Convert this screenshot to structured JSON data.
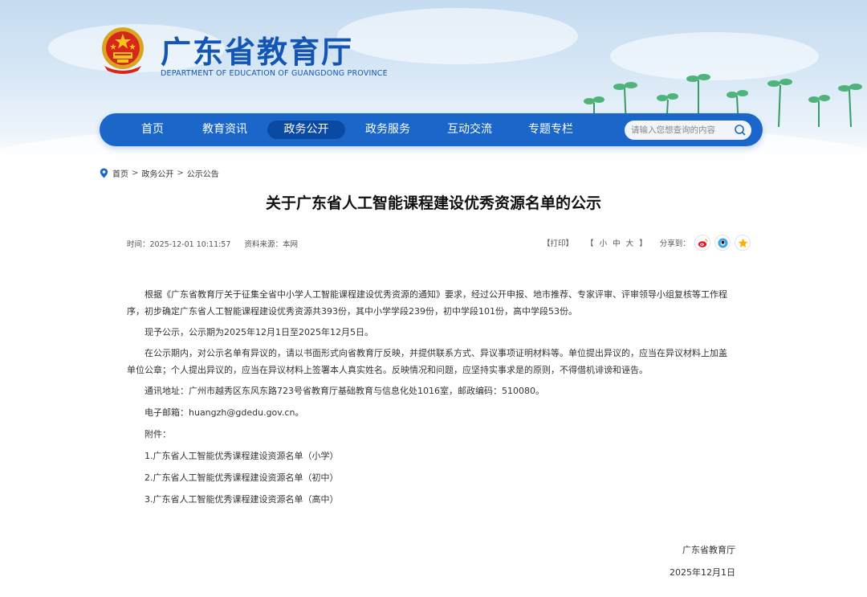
{
  "header": {
    "site_title": "广东省教育厅",
    "site_subtitle": "DEPARTMENT OF EDUCATION OF GUANGDONG PROVINCE"
  },
  "nav": {
    "items": [
      {
        "label": "首页",
        "active": false
      },
      {
        "label": "教育资讯",
        "active": false
      },
      {
        "label": "政务公开",
        "active": true
      },
      {
        "label": "政务服务",
        "active": false
      },
      {
        "label": "互动交流",
        "active": false
      },
      {
        "label": "专题专栏",
        "active": false
      }
    ],
    "search_placeholder": "请输入您想查询的内容"
  },
  "breadcrumb": [
    "首页",
    "政务公开",
    "公示公告"
  ],
  "article": {
    "title": "关于广东省人工智能课程建设优秀资源名单的公示",
    "time_label": "时间：2025-12-01 10:11:57",
    "source_label": "资料来源：本网",
    "print_label": "【打印】",
    "size_open": "【",
    "size_small": "小",
    "size_medium": "中",
    "size_large": "大",
    "size_close": "】",
    "share_label": "分享到：",
    "paragraphs": [
      "根据《广东省教育厅关于征集全省中小学人工智能课程建设优秀资源的通知》要求，经过公开申报、地市推荐、专家评审、评审领导小组复核等工作程序，初步确定广东省人工智能课程建设优秀资源共393份，其中小学学段239份，初中学段101份，高中学段53份。",
      "现予公示，公示期为2025年12月1日至2025年12月5日。",
      "在公示期内，对公示名单有异议的，请以书面形式向省教育厅反映，并提供联系方式、异议事项证明材料等。单位提出异议的，应当在异议材料上加盖单位公章；个人提出异议的，应当在异议材料上签署本人真实姓名。反映情况和问题，应坚持实事求是的原则，不得借机诽谤和诬告。",
      "通讯地址：广州市越秀区东风东路723号省教育厅基础教育与信息化处1016室，邮政编码：510080。",
      "电子邮箱：huangzh@gdedu.gov.cn。",
      "附件：",
      "1.广东省人工智能优秀课程建设资源名单（小学）",
      "2.广东省人工智能优秀课程建设资源名单（初中）",
      "3.广东省人工智能优秀课程建设资源名单（高中）"
    ],
    "signature": "广东省教育厅",
    "date": "2025年12月1日"
  },
  "colors": {
    "brand_blue": "#1a66c9",
    "nav_active": "#0b4aa3",
    "title_blue": "#1556b5"
  },
  "icons": [
    "national-emblem-icon",
    "search-icon",
    "location-pin-icon",
    "weibo-icon",
    "qq-icon",
    "qzone-icon"
  ]
}
